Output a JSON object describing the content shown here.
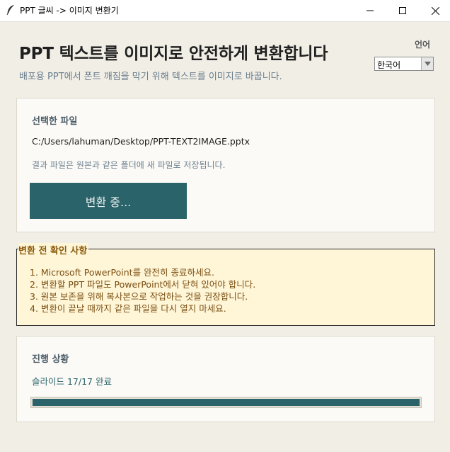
{
  "window": {
    "title": "PPT 글씨 -> 이미지 변환기"
  },
  "header": {
    "title": "PPT 텍스트를 이미지로 안전하게 변환합니다",
    "subtitle": "배포용 PPT에서 폰트 깨짐을 막기 위해 텍스트를 이미지로 바꿉니다."
  },
  "language": {
    "label": "언어",
    "selected": "한국어"
  },
  "file_section": {
    "title": "선택한 파일",
    "path": "C:/Users/lahuman/Desktop/PPT-TEXT2IMAGE.pptx",
    "note": "결과 파일은 원본과 같은 폴더에 새 파일로 저장됩니다.",
    "button_label": "변환 중..."
  },
  "notice": {
    "title": "변환 전 확인 사항",
    "items": [
      "1. Microsoft PowerPoint를 완전히 종료하세요.",
      "2. 변환할 PPT 파일도 PowerPoint에서 닫혀 있어야 합니다.",
      "3. 원본 보존을 위해 복사본으로 작업하는 것을 권장합니다.",
      "4. 변환이 끝날 때까지 같은 파일을 다시 열지 마세요."
    ]
  },
  "progress": {
    "title": "진행 상황",
    "status": "슬라이드 17/17 완료",
    "fraction": 1.0
  },
  "colors": {
    "accent": "#2a6369",
    "notice_bg": "#fff5d7",
    "notice_text": "#7a4f12",
    "background": "#f1eee6"
  },
  "icons": {
    "app": "feather-icon",
    "minimize": "minimize-icon",
    "maximize": "maximize-icon",
    "close": "close-icon",
    "dropdown": "chevron-down-icon"
  }
}
